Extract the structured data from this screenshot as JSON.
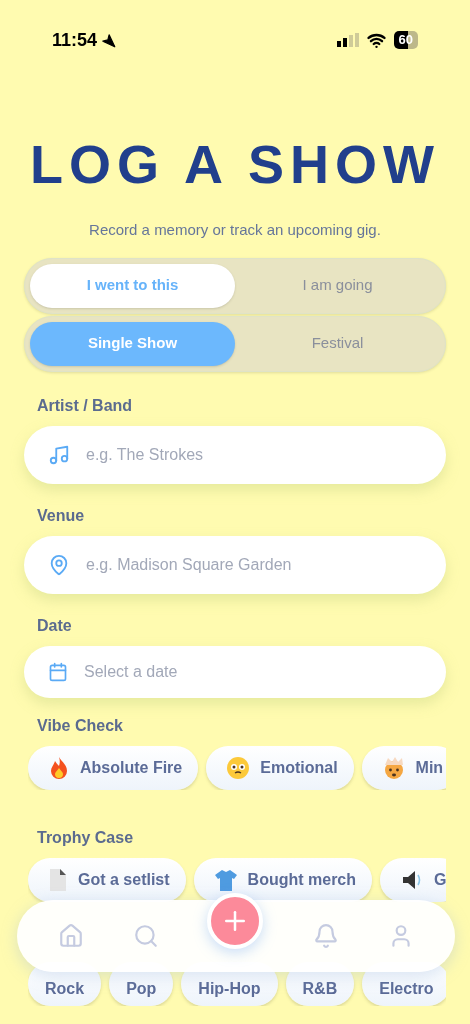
{
  "status_bar": {
    "time": "11:54",
    "battery": "60"
  },
  "title": "LOG A SHOW",
  "subtitle": "Record a memory or track an upcoming gig.",
  "attendance_tabs": [
    {
      "label": "I went to this",
      "selected": true
    },
    {
      "label": "I am going",
      "selected": false
    }
  ],
  "show_type_tabs": [
    {
      "label": "Single Show",
      "selected": true
    },
    {
      "label": "Festival",
      "selected": false
    }
  ],
  "fields": [
    {
      "label": "Artist / Band",
      "placeholder": "e.g. The Strokes",
      "kind": "music"
    },
    {
      "label": "Venue",
      "placeholder": "e.g. Madison Square Garden",
      "kind": "location"
    },
    {
      "label": "Date",
      "placeholder": "Select a date",
      "kind": "date"
    }
  ],
  "vibe_check": {
    "label": "Vibe Check",
    "chips": [
      "Absolute Fire",
      "Emotional",
      "Min"
    ]
  },
  "trophy_case": {
    "label": "Trophy Case",
    "chips": [
      "Got a setlist",
      "Bought merch",
      "G"
    ]
  },
  "genres": [
    "Rock",
    "Pop",
    "Hip-Hop",
    "R&B",
    "Electro"
  ]
}
